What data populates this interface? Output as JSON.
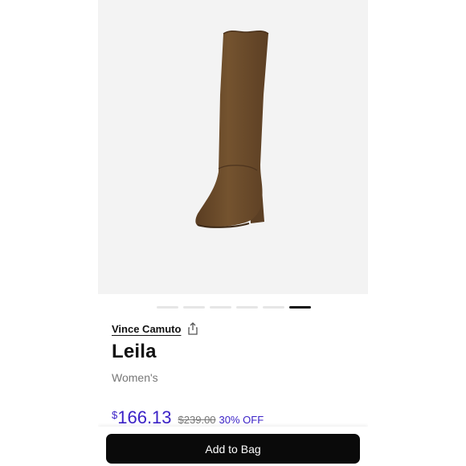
{
  "product": {
    "brand": "Vince Camuto",
    "name": "Leila",
    "category": "Women's",
    "price_symbol": "$",
    "price_value": "166.13",
    "original_price": "$239.00",
    "discount": "30% OFF"
  },
  "carousel": {
    "total": 6,
    "active_index": 5
  },
  "actions": {
    "add_to_bag": "Add to Bag"
  },
  "icons": {
    "share": "share-icon"
  },
  "colors": {
    "accent": "#3b22c7",
    "button_bg": "#0a0a0a",
    "boot": "#6b4a2a"
  }
}
